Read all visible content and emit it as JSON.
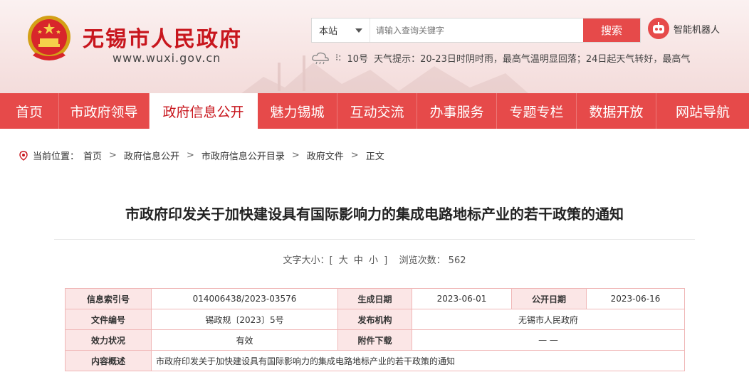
{
  "header": {
    "site_name": "无锡市人民政府",
    "site_url": "www.wuxi.gov.cn",
    "search": {
      "scope": "本站",
      "placeholder": "请输入查询关键字",
      "button": "搜索"
    },
    "robot_label": "智能机器人",
    "weather": {
      "temp": "10号",
      "text": "天气提示：20-23日时阴时雨，最高气温明显回落；24日起天气转好，最高气"
    }
  },
  "nav": [
    {
      "label": "首页",
      "active": false
    },
    {
      "label": "市政府领导",
      "active": false
    },
    {
      "label": "政府信息公开",
      "active": true
    },
    {
      "label": "魅力锡城",
      "active": false
    },
    {
      "label": "互动交流",
      "active": false
    },
    {
      "label": "办事服务",
      "active": false
    },
    {
      "label": "专题专栏",
      "active": false
    },
    {
      "label": "数据开放",
      "active": false
    },
    {
      "label": "网站导航",
      "active": false
    }
  ],
  "breadcrumb": {
    "prefix": "当前位置：",
    "items": [
      "首页",
      "政府信息公开",
      "市政府信息公开目录",
      "政府文件",
      "正文"
    ]
  },
  "article": {
    "title": "市政府印发关于加快建设具有国际影响力的集成电路地标产业的若干政策的通知",
    "font_size_label": "文字大小：[",
    "font_large": "大",
    "font_medium": "中",
    "font_small": "小",
    "font_size_close": "]",
    "views_label": "浏览次数：",
    "views": "562"
  },
  "info_table": {
    "index_label": "信息索引号",
    "index_value": "014006438/2023-03576",
    "gen_date_label": "生成日期",
    "gen_date_value": "2023-06-01",
    "pub_date_label": "公开日期",
    "pub_date_value": "2023-06-16",
    "doc_no_label": "文件编号",
    "doc_no_value": "锡政规〔2023〕5号",
    "issuer_label": "发布机构",
    "issuer_value": "无锡市人民政府",
    "status_label": "效力状况",
    "status_value": "有效",
    "attach_label": "附件下载",
    "attach_value": "— —",
    "summary_label": "内容概述",
    "summary_value": "市政府印发关于加快建设具有国际影响力的集成电路地标产业的若干政策的通知"
  },
  "colors": {
    "brand_red": "#c8161d",
    "nav_red": "#e64a4a",
    "table_label_bg": "#fbe6e6",
    "table_border": "#f0b7b7"
  }
}
